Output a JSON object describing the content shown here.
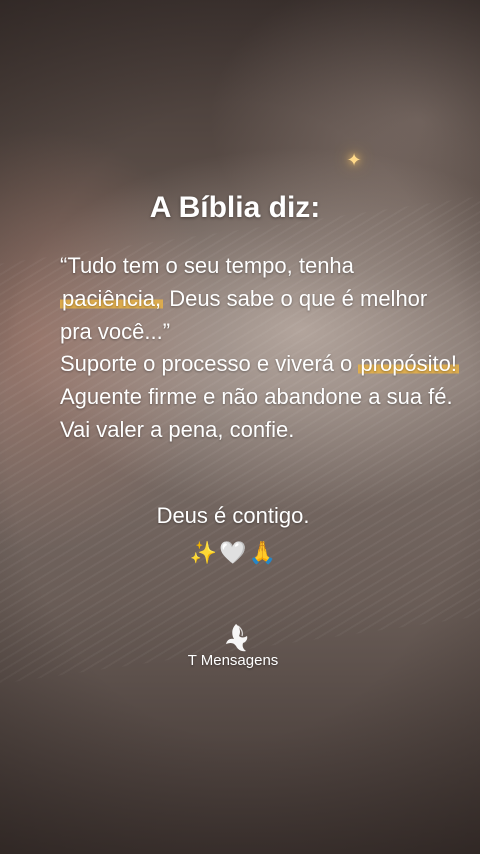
{
  "title": "A Bíblia diz:",
  "body": {
    "line1_before": "“Tudo tem o seu tempo, tenha ",
    "highlight1": "paciência,",
    "line1_after": " Deus sabe o que é melhor pra você...”",
    "line2_before": "Suporte o processo e viverá o ",
    "highlight2": "propósito!",
    "line3": "Aguente firme e não abandone a sua fé. Vai valer a pena, confie."
  },
  "closing": "Deus é contigo.",
  "emojis": {
    "sparkles": "✨",
    "heart": "🤍",
    "pray": "🙏"
  },
  "sparkle_glyph": "✦",
  "brand": "T Mensagens",
  "colors": {
    "highlight": "#e8b246",
    "text": "#ffffff",
    "sparkle": "#ffd98a"
  }
}
